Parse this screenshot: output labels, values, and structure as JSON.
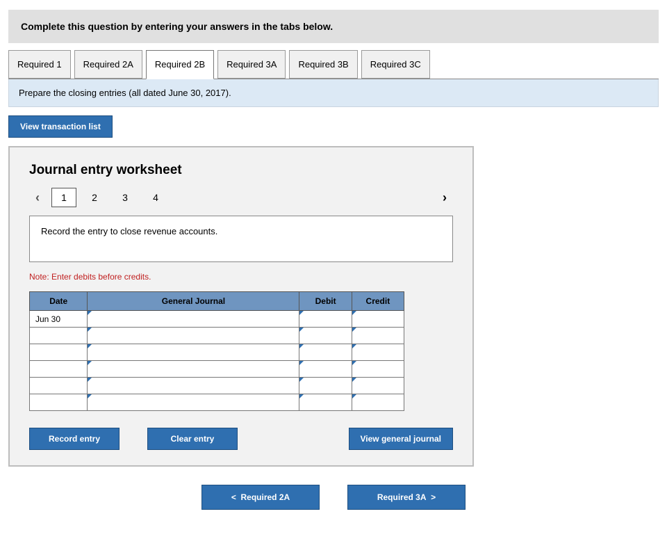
{
  "instruction": "Complete this question by entering your answers in the tabs below.",
  "tabs": [
    {
      "label": "Required 1"
    },
    {
      "label": "Required 2A"
    },
    {
      "label": "Required 2B"
    },
    {
      "label": "Required 3A"
    },
    {
      "label": "Required 3B"
    },
    {
      "label": "Required 3C"
    }
  ],
  "active_tab_index": 2,
  "tab_prompt": "Prepare the closing entries (all dated June 30, 2017).",
  "view_transaction_btn": "View transaction list",
  "worksheet": {
    "title": "Journal entry worksheet",
    "entries": [
      "1",
      "2",
      "3",
      "4"
    ],
    "active_entry_index": 0,
    "entry_prompt": "Record the entry to close revenue accounts.",
    "note": "Note: Enter debits before credits.",
    "columns": {
      "date": "Date",
      "gj": "General Journal",
      "debit": "Debit",
      "credit": "Credit"
    },
    "rows": [
      {
        "date": "Jun 30",
        "gj": "",
        "debit": "",
        "credit": ""
      },
      {
        "date": "",
        "gj": "",
        "debit": "",
        "credit": ""
      },
      {
        "date": "",
        "gj": "",
        "debit": "",
        "credit": ""
      },
      {
        "date": "",
        "gj": "",
        "debit": "",
        "credit": ""
      },
      {
        "date": "",
        "gj": "",
        "debit": "",
        "credit": ""
      },
      {
        "date": "",
        "gj": "",
        "debit": "",
        "credit": ""
      }
    ],
    "buttons": {
      "record": "Record entry",
      "clear": "Clear entry",
      "view": "View general journal"
    }
  },
  "bottom_nav": {
    "prev": "Required 2A",
    "next": "Required 3A"
  },
  "glyphs": {
    "left": "‹",
    "right": "›",
    "chev_left": "<",
    "chev_right": ">"
  }
}
